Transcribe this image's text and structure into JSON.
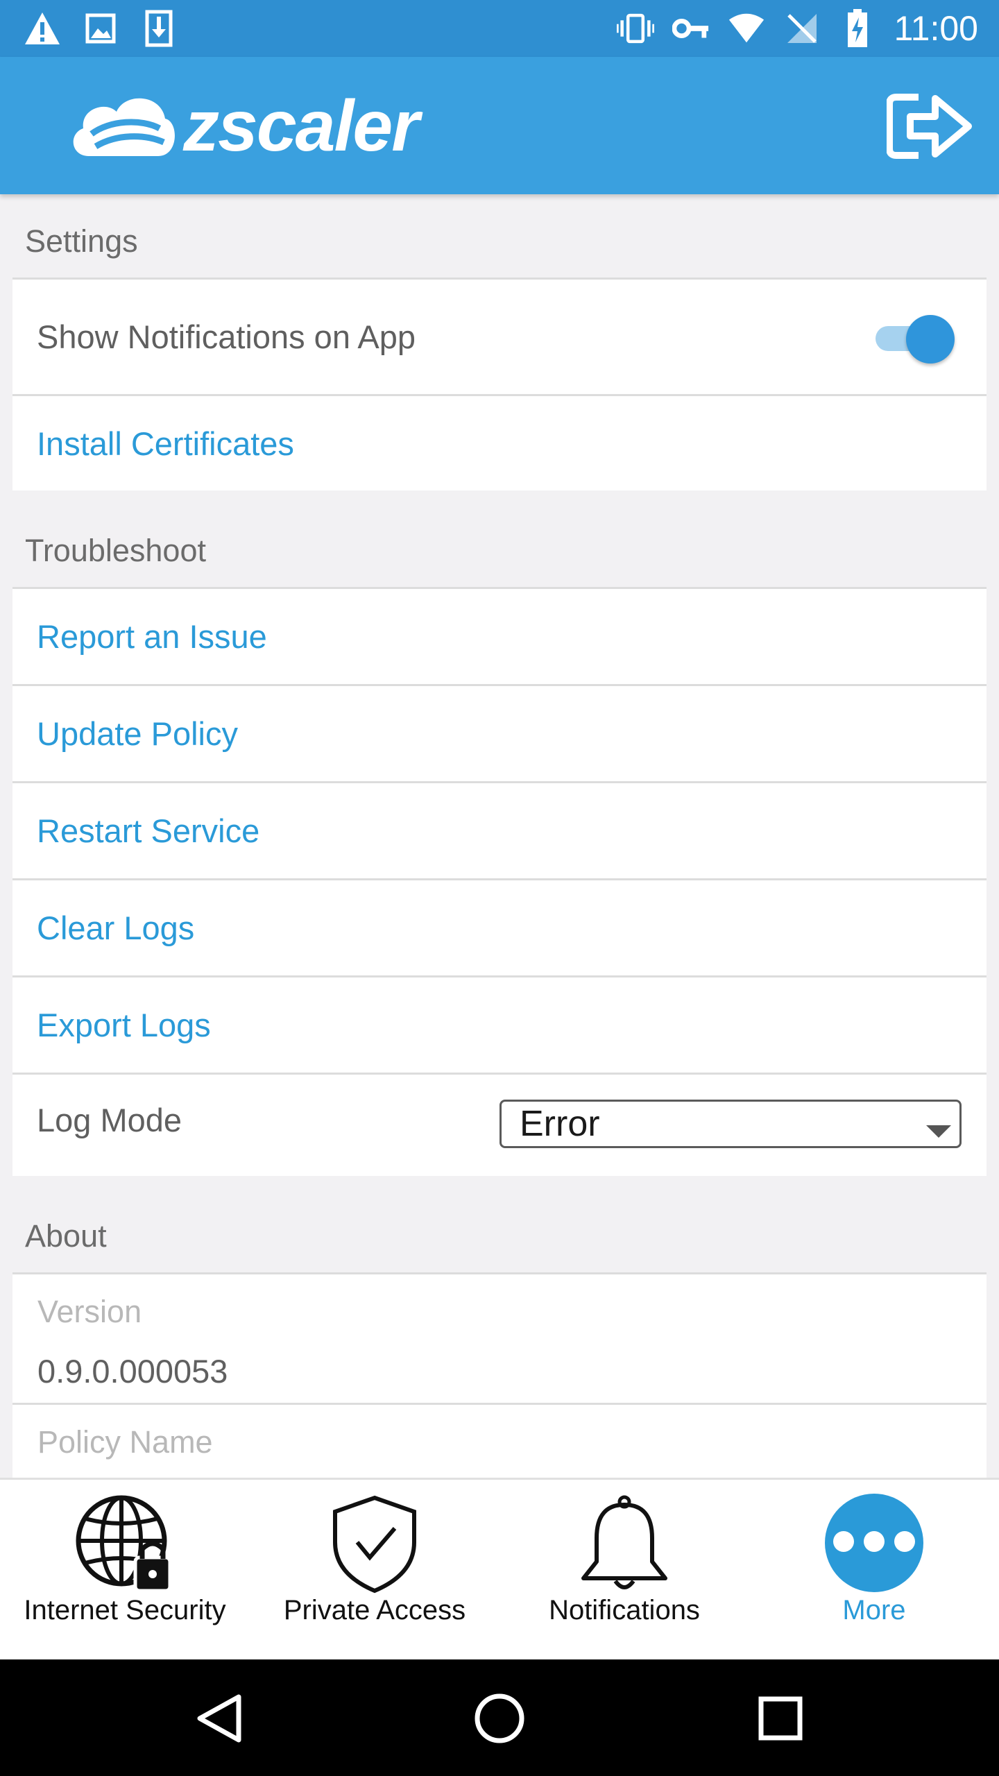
{
  "status_bar": {
    "time": "11:00",
    "left_icons": [
      "warning-icon",
      "image-icon",
      "download-icon"
    ],
    "right_icons": [
      "vibrate-icon",
      "vpn-key-icon",
      "wifi-icon",
      "no-signal-icon",
      "battery-charging-icon"
    ]
  },
  "app_bar": {
    "logo_text": "zscaler",
    "logout_icon": "logout-icon"
  },
  "settings": {
    "header": "Settings",
    "show_notifications_label": "Show Notifications on App",
    "show_notifications_enabled": true,
    "install_certificates": "Install Certificates"
  },
  "troubleshoot": {
    "header": "Troubleshoot",
    "report_issue": "Report an Issue",
    "update_policy": "Update Policy",
    "restart_service": "Restart Service",
    "clear_logs": "Clear Logs",
    "export_logs": "Export Logs",
    "log_mode_label": "Log Mode",
    "log_mode_value": "Error"
  },
  "about": {
    "header": "About",
    "version_label": "Version",
    "version_value": "0.9.0.000053",
    "policy_name_label": "Policy Name"
  },
  "bottom_nav": {
    "items": [
      {
        "label": "Internet Security",
        "icon": "globe-lock-icon",
        "active": false
      },
      {
        "label": "Private Access",
        "icon": "shield-check-icon",
        "active": false
      },
      {
        "label": "Notifications",
        "icon": "bell-icon",
        "active": false
      },
      {
        "label": "More",
        "icon": "more-icon",
        "active": true
      }
    ],
    "active_color": "#2a9ad8"
  },
  "colors": {
    "status_bar": "#2f8fd1",
    "app_bar": "#3aa0df",
    "link": "#2a9ad8"
  }
}
